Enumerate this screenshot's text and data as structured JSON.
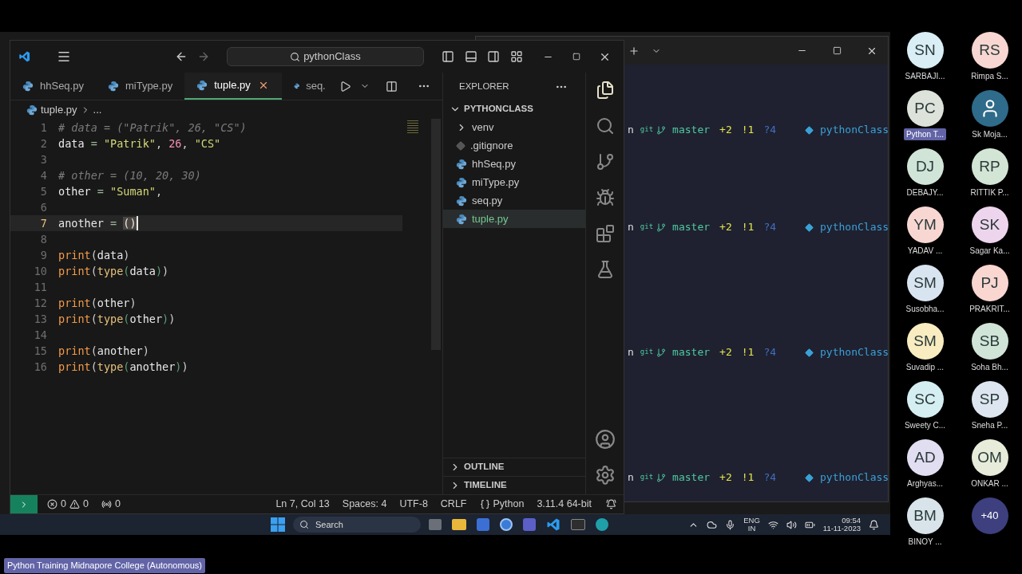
{
  "vscode": {
    "title_search": "pythonClass",
    "tabs": [
      {
        "label": "hhSeq.py",
        "selected": false
      },
      {
        "label": "miType.py",
        "selected": false
      },
      {
        "label": "tuple.py",
        "selected": true
      },
      {
        "label": "seq.",
        "selected": false
      }
    ],
    "breadcrumb": {
      "file": "tuple.py",
      "more": "..."
    },
    "code_lines": [
      {
        "number": "1",
        "current": false,
        "tokens": [
          {
            "kind": "comment",
            "text": "# data = (\"Patrik\", 26, \"CS\")"
          }
        ]
      },
      {
        "number": "2",
        "current": false,
        "tokens": [
          {
            "kind": "ident",
            "text": "data"
          },
          {
            "kind": "op",
            "text": " = "
          },
          {
            "kind": "string",
            "text": "\"Patrik\""
          },
          {
            "kind": "punct",
            "text": ", "
          },
          {
            "kind": "number",
            "text": "26"
          },
          {
            "kind": "punct",
            "text": ", "
          },
          {
            "kind": "string",
            "text": "\"CS\""
          }
        ]
      },
      {
        "number": "3",
        "current": false
      },
      {
        "number": "4",
        "current": false,
        "tokens": [
          {
            "kind": "comment",
            "text": "# other = (10, 20, 30)"
          }
        ]
      },
      {
        "number": "5",
        "current": false,
        "tokens": [
          {
            "kind": "ident",
            "text": "other"
          },
          {
            "kind": "op",
            "text": " = "
          },
          {
            "kind": "string",
            "text": "\"Suman\""
          },
          {
            "kind": "punct",
            "text": ","
          }
        ]
      },
      {
        "number": "6",
        "current": false
      },
      {
        "number": "7",
        "current": true,
        "tokens": [
          {
            "kind": "ident",
            "text": "another"
          },
          {
            "kind": "op",
            "text": " = "
          },
          {
            "kind": "bracket",
            "text": "()"
          }
        ]
      },
      {
        "number": "8",
        "current": false
      },
      {
        "number": "9",
        "current": false,
        "tokens": [
          {
            "kind": "func",
            "text": "print"
          },
          {
            "kind": "punct",
            "text": "("
          },
          {
            "kind": "ident",
            "text": "data"
          },
          {
            "kind": "punct",
            "text": ")"
          }
        ]
      },
      {
        "number": "10",
        "current": false,
        "tokens": [
          {
            "kind": "func",
            "text": "print"
          },
          {
            "kind": "punct",
            "text": "("
          },
          {
            "kind": "builtin",
            "text": "type"
          },
          {
            "kind": "paren2",
            "text": "("
          },
          {
            "kind": "ident",
            "text": "data"
          },
          {
            "kind": "paren2",
            "text": ")"
          },
          {
            "kind": "punct",
            "text": ")"
          }
        ]
      },
      {
        "number": "11",
        "current": false
      },
      {
        "number": "12",
        "current": false,
        "tokens": [
          {
            "kind": "func",
            "text": "print"
          },
          {
            "kind": "punct",
            "text": "("
          },
          {
            "kind": "ident",
            "text": "other"
          },
          {
            "kind": "punct",
            "text": ")"
          }
        ]
      },
      {
        "number": "13",
        "current": false,
        "tokens": [
          {
            "kind": "func",
            "text": "print"
          },
          {
            "kind": "punct",
            "text": "("
          },
          {
            "kind": "builtin",
            "text": "type"
          },
          {
            "kind": "paren2",
            "text": "("
          },
          {
            "kind": "ident",
            "text": "other"
          },
          {
            "kind": "paren2",
            "text": ")"
          },
          {
            "kind": "punct",
            "text": ")"
          }
        ]
      },
      {
        "number": "14",
        "current": false
      },
      {
        "number": "15",
        "current": false,
        "tokens": [
          {
            "kind": "func",
            "text": "print"
          },
          {
            "kind": "punct",
            "text": "("
          },
          {
            "kind": "ident",
            "text": "another"
          },
          {
            "kind": "punct",
            "text": ")"
          }
        ]
      },
      {
        "number": "16",
        "current": false,
        "tokens": [
          {
            "kind": "func",
            "text": "print"
          },
          {
            "kind": "punct",
            "text": "("
          },
          {
            "kind": "builtin",
            "text": "type"
          },
          {
            "kind": "paren2",
            "text": "("
          },
          {
            "kind": "ident",
            "text": "another"
          },
          {
            "kind": "paren2",
            "text": ")"
          },
          {
            "kind": "punct",
            "text": ")"
          }
        ]
      }
    ],
    "explorer": {
      "title": "EXPLORER",
      "root": "PYTHONCLASS",
      "expanded": true,
      "items": [
        {
          "label": "venv",
          "kind": "folder",
          "selected": false
        },
        {
          "label": ".gitignore",
          "kind": "git",
          "selected": false
        },
        {
          "label": "hhSeq.py",
          "kind": "python",
          "selected": false
        },
        {
          "label": "miType.py",
          "kind": "python",
          "selected": false
        },
        {
          "label": "seq.py",
          "kind": "python",
          "selected": false
        },
        {
          "label": "tuple.py",
          "kind": "python",
          "selected": true
        }
      ],
      "sections": [
        {
          "label": "OUTLINE",
          "expanded": false
        },
        {
          "label": "TIMELINE",
          "expanded": false
        }
      ]
    },
    "status_bar": {
      "errors": "0",
      "warnings": "0",
      "ports": "0",
      "position": "Ln 7, Col 13",
      "spaces": "Spaces: 4",
      "encoding": "UTF-8",
      "eol": "CRLF",
      "language": "Python",
      "interpreter": "3.11.4 64-bit"
    }
  },
  "terminal": {
    "prompts": [
      {
        "prefix": "n",
        "git": "git",
        "branch": "master",
        "staged": "+2",
        "modified": "!1",
        "untracked": "?4",
        "env": "pythonClass"
      },
      {
        "prefix": "n",
        "git": "git",
        "branch": "master",
        "staged": "+2",
        "modified": "!1",
        "untracked": "?4",
        "env": "pythonClass"
      },
      {
        "prefix": "n",
        "git": "git",
        "branch": "master",
        "staged": "+2",
        "modified": "!1",
        "untracked": "?4",
        "env": "pythonClass"
      },
      {
        "prefix": "n",
        "git": "git",
        "branch": "master",
        "staged": "+2",
        "modified": "!1",
        "untracked": "?4",
        "env": "pythonClass"
      }
    ]
  },
  "taskbar": {
    "search": "Search",
    "language": "ENG",
    "region": "IN",
    "time": "09:54",
    "date": "11-11-2023"
  },
  "participants": [
    {
      "kind": "initials",
      "initials": "SN",
      "name": "SARBAJI...",
      "color": "#d9eef5",
      "presenting": false
    },
    {
      "kind": "initials",
      "initials": "RS",
      "name": "Rimpa S...",
      "color": "#f8d7d2",
      "presenting": false
    },
    {
      "kind": "initials",
      "initials": "PC",
      "name": "Python T...",
      "color": "#dde3da",
      "presenting": true
    },
    {
      "kind": "avatar",
      "name": "Sk Moja...",
      "color": "#2f6b8a",
      "presenting": false
    },
    {
      "kind": "initials",
      "initials": "DJ",
      "name": "DEBAJY...",
      "color": "#d0e5d8",
      "presenting": false
    },
    {
      "kind": "initials",
      "initials": "RP",
      "name": "RITTIK P...",
      "color": "#d3e6d6",
      "presenting": false
    },
    {
      "kind": "initials",
      "initials": "YM",
      "name": "YADAV ...",
      "color": "#f8d7d2",
      "presenting": false
    },
    {
      "kind": "initials",
      "initials": "SK",
      "name": "Sagar Ka...",
      "color": "#eed5ee",
      "presenting": false
    },
    {
      "kind": "initials",
      "initials": "SM",
      "name": "Susobha...",
      "color": "#d8e4f0",
      "presenting": false
    },
    {
      "kind": "initials",
      "initials": "PJ",
      "name": "PRAKRIT...",
      "color": "#f9d6d0",
      "presenting": false
    },
    {
      "kind": "initials",
      "initials": "SM",
      "name": "Suvadip ...",
      "color": "#f8ecc0",
      "presenting": false
    },
    {
      "kind": "initials",
      "initials": "SB",
      "name": "Soha Bh...",
      "color": "#d0e5d8",
      "presenting": false
    },
    {
      "kind": "initials",
      "initials": "SC",
      "name": "Sweety C...",
      "color": "#d5eef2",
      "presenting": false
    },
    {
      "kind": "initials",
      "initials": "SP",
      "name": "Sneha P...",
      "color": "#dde6f0",
      "presenting": false
    },
    {
      "kind": "initials",
      "initials": "AD",
      "name": "Arghyas...",
      "color": "#e2def2",
      "presenting": false
    },
    {
      "kind": "initials",
      "initials": "OM",
      "name": "ONKAR ...",
      "color": "#e6ecd9",
      "presenting": false
    },
    {
      "kind": "initials",
      "initials": "BM",
      "name": "BINOY ...",
      "color": "#d8e4ea",
      "presenting": false
    },
    {
      "kind": "overflow",
      "initials": "+40",
      "color": "#3d3f7e"
    }
  ],
  "meeting_label": "Python Training Midnapore College (Autonomous)"
}
